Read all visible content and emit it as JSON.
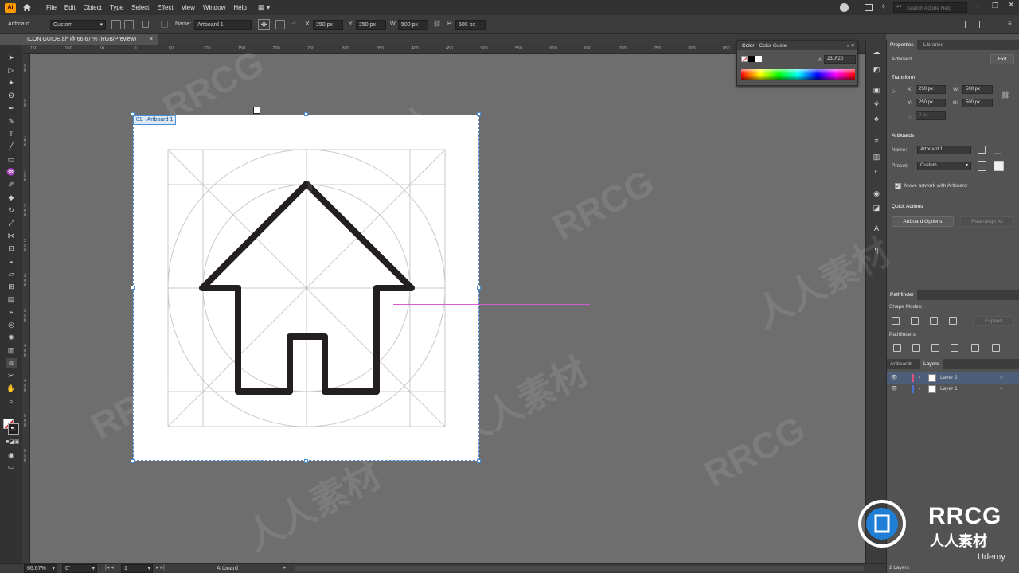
{
  "app": {
    "logo_text": "Ai",
    "home_icon": "home-icon"
  },
  "menu": {
    "items": [
      "File",
      "Edit",
      "Object",
      "Type",
      "Select",
      "Effect",
      "View",
      "Window",
      "Help"
    ]
  },
  "search": {
    "placeholder": "Search Adobe Help"
  },
  "control_bar": {
    "mode_label": "Artboard",
    "preset_value": "Custom",
    "name_label": "Name:",
    "name_value": "Artboard 1",
    "x_label": "X:",
    "x_value": "250 px",
    "y_label": "Y:",
    "y_value": "250 px",
    "w_label": "W:",
    "w_value": "500 px",
    "h_label": "H:",
    "h_value": "500 px"
  },
  "document_tab": {
    "title": "ICON GUIDE.ai* @ 66.67 % (RGB/Preview)",
    "close": "×"
  },
  "rulers": {
    "top_ticks": [
      "150",
      "100",
      "50",
      "0",
      "50",
      "100",
      "150",
      "200",
      "250",
      "300",
      "350",
      "400",
      "450",
      "500",
      "550",
      "600",
      "650",
      "700",
      "750",
      "800",
      "850",
      "900",
      "950"
    ],
    "left_ticks": [
      "5\n0",
      "5\n0",
      "1\n0\n0",
      "1\n5\n0",
      "2\n0\n0",
      "2\n5\n0",
      "3\n0\n0",
      "3\n5\n0",
      "4\n0\n0",
      "4\n5\n0",
      "5\n0\n0",
      "5\n5\n0"
    ]
  },
  "artboard": {
    "label": "01 - Artboard 1",
    "stroke_color": "#231F20"
  },
  "color_panel": {
    "tab_color": "Color",
    "tab_guide": "Color Guide",
    "hex_symbol": "#",
    "hex_value": "231F20"
  },
  "right_panel": {
    "tab_properties": "Properties",
    "tab_libraries": "Libraries",
    "section_label": "Artboard",
    "exit_button": "Exit",
    "transform_title": "Transform",
    "x_label": "X:",
    "x_value": "250 px",
    "y_label": "Y:",
    "y_value": "250 px",
    "w_label": "W:",
    "w_value": "500 px",
    "h_label": "H:",
    "h_value": "500 px",
    "angle_value": "0 px",
    "artboards_title": "Artboards",
    "name_label": "Name:",
    "name_value": "Artboard 1",
    "preset_label": "Preset:",
    "preset_value": "Custom",
    "move_artwork_label": "Move artwork with Artboard",
    "quick_actions_title": "Quick Actions",
    "artboard_options_button": "Artboard Options",
    "rearrange_all_button": "Rearrange All"
  },
  "pathfinder": {
    "title": "Pathfinder",
    "shape_modes_label": "Shape Modes:",
    "expand_button": "Expand",
    "pathfinders_label": "Pathfinders:"
  },
  "layers_panel": {
    "tab_artboards": "Artboards",
    "tab_layers": "Layers",
    "layers": [
      {
        "name": "Layer 2",
        "color": "#e0507a"
      },
      {
        "name": "Layer 1",
        "color": "#4a6fd6"
      }
    ],
    "count_label": "2 Layers"
  },
  "status_bar": {
    "zoom_value": "66.67%",
    "rotation_value": "0°",
    "artboard_number": "1",
    "mode_label": "Artboard"
  },
  "watermarks": {
    "text_latin": "RRCG",
    "text_cjk": "人人素材"
  },
  "logo": {
    "brand": "RRCG",
    "cjk": "人人素材",
    "udemy": "Udemy"
  }
}
